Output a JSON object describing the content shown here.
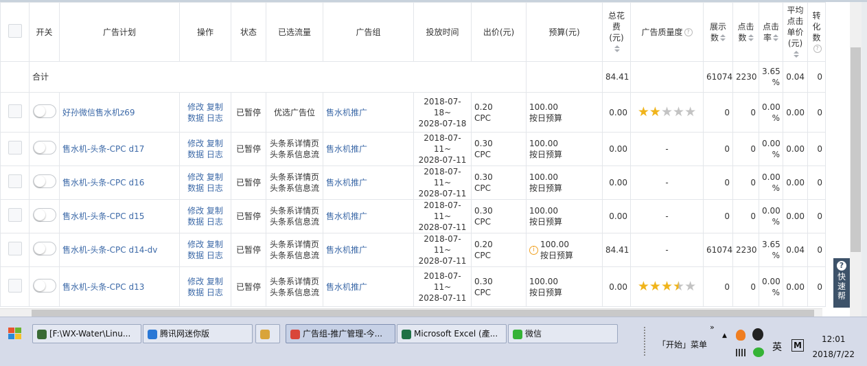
{
  "table": {
    "headers": {
      "switch": "开关",
      "plan": "广告计划",
      "ops": "操作",
      "status": "状态",
      "traffic": "已选流量",
      "group": "广告组",
      "time": "投放时间",
      "bid": "出价(元)",
      "budget": "预算(元)",
      "cost": "总花费(元)",
      "quality": "广告质量度",
      "impr": "展示数",
      "clicks": "点击数",
      "ctr": "点击率",
      "cpc": "平均点击单价(元)",
      "conv": "转化数"
    },
    "summary": {
      "label": "合计",
      "cost": "84.41",
      "impr": "61074",
      "clicks": "2230",
      "ctr": "3.65 %",
      "cpc": "0.04",
      "conv": "0"
    },
    "op_labels": {
      "edit": "修改",
      "copy": "复制",
      "data": "数据",
      "log": "日志"
    },
    "rows": [
      {
        "plan": "好孙微信售水机z69",
        "status": "已暂停",
        "traffic1": "优选广告位",
        "traffic2": "",
        "group": "售水机推广",
        "time1": "2018-07-18~",
        "time2": "2028-07-18",
        "bid": "0.20",
        "bid_type": "CPC",
        "budget": "100.00",
        "budget_type": "按日预算",
        "warn": false,
        "cost": "0.00",
        "quality_stars": 2,
        "quality_text": "",
        "impr": "0",
        "clicks": "0",
        "ctr": "0.00 %",
        "cpc": "0.00",
        "conv": "0"
      },
      {
        "plan": "售水机-头条-CPC d17",
        "status": "已暂停",
        "traffic1": "头条系详情页",
        "traffic2": "头条系信息流",
        "group": "售水机推广",
        "time1": "2018-07-11~",
        "time2": "2028-07-11",
        "bid": "0.30",
        "bid_type": "CPC",
        "budget": "100.00",
        "budget_type": "按日预算",
        "warn": false,
        "cost": "0.00",
        "quality_stars": null,
        "quality_text": "-",
        "impr": "0",
        "clicks": "0",
        "ctr": "0.00 %",
        "cpc": "0.00",
        "conv": "0"
      },
      {
        "plan": "售水机-头条-CPC d16",
        "status": "已暂停",
        "traffic1": "头条系详情页",
        "traffic2": "头条系信息流",
        "group": "售水机推广",
        "time1": "2018-07-11~",
        "time2": "2028-07-11",
        "bid": "0.30",
        "bid_type": "CPC",
        "budget": "100.00",
        "budget_type": "按日预算",
        "warn": false,
        "cost": "0.00",
        "quality_stars": null,
        "quality_text": "-",
        "impr": "0",
        "clicks": "0",
        "ctr": "0.00 %",
        "cpc": "0.00",
        "conv": "0"
      },
      {
        "plan": "售水机-头条-CPC d15",
        "status": "已暂停",
        "traffic1": "头条系详情页",
        "traffic2": "头条系信息流",
        "group": "售水机推广",
        "time1": "2018-07-11~",
        "time2": "2028-07-11",
        "bid": "0.30",
        "bid_type": "CPC",
        "budget": "100.00",
        "budget_type": "按日预算",
        "warn": false,
        "cost": "0.00",
        "quality_stars": null,
        "quality_text": "-",
        "impr": "0",
        "clicks": "0",
        "ctr": "0.00 %",
        "cpc": "0.00",
        "conv": "0"
      },
      {
        "plan": "售水机-头条-CPC d14-dv",
        "status": "已暂停",
        "traffic1": "头条系详情页",
        "traffic2": "头条系信息流",
        "group": "售水机推广",
        "time1": "2018-07-11~",
        "time2": "2028-07-11",
        "bid": "0.20",
        "bid_type": "CPC",
        "budget": "100.00",
        "budget_type": "按日预算",
        "warn": true,
        "cost": "84.41",
        "quality_stars": null,
        "quality_text": "-",
        "impr": "61074",
        "clicks": "2230",
        "ctr": "3.65 %",
        "cpc": "0.04",
        "conv": "0"
      },
      {
        "plan": "售水机-头条-CPC d13",
        "status": "已暂停",
        "traffic1": "头条系详情页",
        "traffic2": "头条系信息流",
        "group": "售水机推广",
        "time1": "2018-07-11~",
        "time2": "2028-07-11",
        "bid": "0.30",
        "bid_type": "CPC",
        "budget": "100.00",
        "budget_type": "按日预算",
        "warn": false,
        "cost": "0.00",
        "quality_stars": 3.5,
        "quality_text": "",
        "impr": "0",
        "clicks": "0",
        "ctr": "0.00 %",
        "cpc": "0.00",
        "conv": "0"
      }
    ]
  },
  "quick_help": {
    "label1": "快",
    "label2": "速",
    "label3": "帮"
  },
  "taskbar": {
    "buttons": [
      {
        "label": "[F:\\WX-Water\\Linu...",
        "icon_color": "#3a6b35"
      },
      {
        "label": "腾讯网迷你版",
        "icon_color": "#2a78d6"
      },
      {
        "label": "",
        "icon_color": "#d9a43a"
      },
      {
        "label": "广告组-推广管理-今...",
        "icon_color": "#d9463a"
      },
      {
        "label": "Microsoft Excel (產...",
        "icon_color": "#1e7145"
      },
      {
        "label": "微信",
        "icon_color": "#35b336"
      }
    ],
    "start_menu_label": "「开始」菜单",
    "ime_label": "英",
    "ime_mode": "M",
    "time": "12:01",
    "date": "2018/7/22"
  }
}
